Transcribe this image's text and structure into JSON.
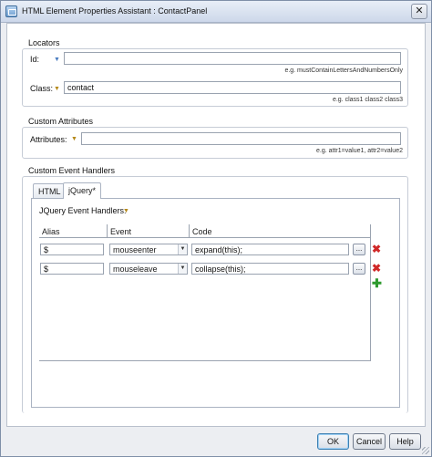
{
  "window": {
    "title": "HTML Element Properties Assistant : ContactPanel",
    "close_glyph": "✕"
  },
  "locators": {
    "title": "Locators",
    "id_label": "Id:",
    "id_value": "",
    "id_hint": "e.g. mustContainLettersAndNumbersOnly",
    "class_label": "Class:",
    "class_value": "contact",
    "class_hint": "e.g. class1 class2 class3"
  },
  "custom_attributes": {
    "title": "Custom Attributes",
    "attributes_label": "Attributes:",
    "attributes_value": "",
    "attributes_hint": "e.g. attr1=value1, attr2=value2"
  },
  "event_handlers": {
    "title": "Custom Event Handlers",
    "tabs": [
      {
        "label": "HTML"
      },
      {
        "label": "jQuery*"
      }
    ],
    "active_tab": "jQuery*",
    "jquery_label": "JQuery Event Handlers:",
    "columns": [
      "Alias",
      "Event",
      "Code"
    ],
    "rows": [
      {
        "alias": "$",
        "event": "mouseenter",
        "code": "expand(this);",
        "more": "..."
      },
      {
        "alias": "$",
        "event": "mouseleave",
        "code": "collapse(this);",
        "more": "..."
      }
    ]
  },
  "icons": {
    "chevron": "chevron-down-icon",
    "delete": "delete-icon",
    "add": "add-icon"
  },
  "footer": {
    "ok_label": "OK",
    "cancel_label": "Cancel",
    "help_label": "Help"
  },
  "colors": {
    "delete": "#d02828",
    "add": "#2e9a2e",
    "chevron_blue": "#4a7cc0",
    "chevron_gold": "#b5891a"
  }
}
